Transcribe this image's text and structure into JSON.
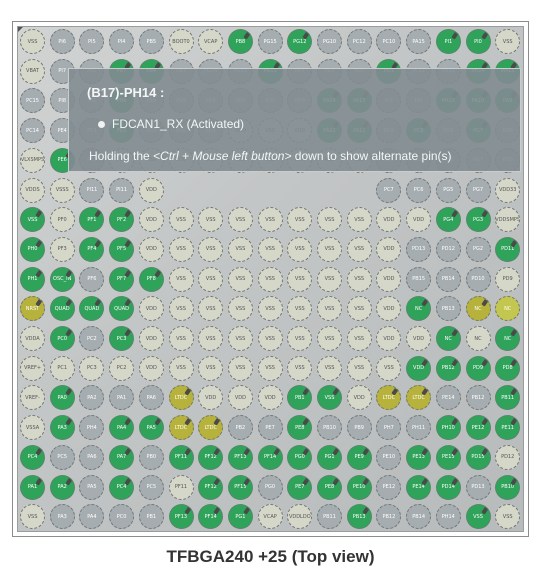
{
  "package": {
    "caption": "TFBGA240 +25 (Top view)",
    "grid_rows": 17,
    "grid_cols": 17,
    "colors": {
      "power_ground": "#d5d7c9",
      "io_unused": "#a6adb1",
      "active": "#2fa35a",
      "reserved": "#b6b23c",
      "nc": "#c3c64f",
      "body": "#c3c6c6"
    }
  },
  "tooltip": {
    "title": "(B17)-PH14 :",
    "signal": "FDCAN1_RX (Activated)",
    "hint_pre": "Holding the ",
    "hint_italic": "<Ctrl + Mouse left button>",
    "hint_post": " down to show alternate pin(s)"
  },
  "balls": [
    [
      "VSS:g",
      "PI6:i",
      "PI5:i",
      "PI4:i",
      "PB5:i",
      "BOOT0:g",
      "VCAP:g",
      "PB8:a",
      "PG15:i",
      "PG12:a",
      "PG10:i",
      "PC12:i",
      "PC10:i",
      "PA15:i",
      "PI1:a",
      "PI0:a",
      "VSS:g"
    ],
    [
      "VBAT:g",
      "PI7:i",
      "PE1:i",
      "PB7:a",
      "PB4:a",
      "PB3:i",
      "PG14:i",
      "PG13:i",
      "PG11:a",
      "PD7:i",
      "PD5:i",
      "PD3:i",
      "PD1:a",
      "PC11:i",
      "PH15:i",
      "PH14:a",
      "PH13:a"
    ],
    [
      "PC15:i",
      "PI8:i",
      "PE0:i",
      "PB6:a",
      "PB9:i",
      "PG9:i",
      "PD6:i",
      "PD4:i",
      "PD2:i",
      "PD0:i",
      "PA14:a",
      "PA13:a",
      "PI3:i",
      "PI2:i",
      "PH12:a",
      "PA10:a",
      "PA9:a"
    ],
    [
      "PC14:i",
      "PE4:i",
      "PE3:i",
      "PE2:a",
      "PG9:i",
      "PD6:i",
      "PD4:i",
      "VDD:g",
      "VSS:g",
      "VDD:g",
      "PA12:a",
      "PA11:a",
      "PC9:i",
      "PC8:a",
      "PG8:i",
      "PG7:a",
      "PG6:i"
    ],
    [
      "VLXSMPS:g",
      "PE6:a",
      "PE5:i",
      "VDD:g",
      "VSS:g",
      "VDD:g",
      "VSS:g",
      "VDD:g",
      "VSS:g",
      "VDD:g",
      "VSS:g",
      "VDD:g",
      "PC9:i",
      "PC8:i",
      "PG8:i",
      "PG7:i",
      "PG6:i"
    ],
    [
      "VDDS:g",
      "VSSS:g",
      "PI11:i",
      "PI11:i",
      "VDD:g",
      "",
      "",
      "",
      "",
      "",
      "",
      "",
      "PC7:i",
      "PC6:i",
      "PG5:i",
      "PG7:i",
      "VDD33:g"
    ],
    [
      "VSS:a",
      "PF0:g",
      "PF1:a",
      "PF2:a",
      "VDD:g",
      "VSS:g",
      "VSS:g",
      "VSS:g",
      "VSS:g",
      "VSS:g",
      "VSS:g",
      "VSS:g",
      "VDD:g",
      "VDD:g",
      "PG4:a",
      "PG3:a",
      "VDDSMPS:g"
    ],
    [
      "PH0:a",
      "PF3:g",
      "PF4:a",
      "PF5:a",
      "VDD:g",
      "VSS:g",
      "VSS:g",
      "VSS:g",
      "VSS:g",
      "VSS:g",
      "VSS:g",
      "VSS:g",
      "VDD:g",
      "PD13:i",
      "PD12:i",
      "PG2:i",
      "PD11:a"
    ],
    [
      "PH1:a",
      "OSC_IN:a",
      "PF6:i",
      "PF7:a",
      "PF8:a",
      "VSS:g",
      "VSS:g",
      "VSS:g",
      "VSS:g",
      "VSS:g",
      "VSS:g",
      "VSS:g",
      "VDD:g",
      "PB15:i",
      "PB14:i",
      "PD10:i",
      "PD9:g"
    ],
    [
      "NRST:r",
      "QUAD:a",
      "QUAD:a",
      "QUAD:a",
      "VDD:g",
      "VSS:g",
      "VSS:g",
      "VSS:g",
      "VSS:g",
      "VSS:g",
      "VSS:g",
      "VSS:g",
      "VDD:g",
      "NC:a",
      "PB13:i",
      "NC:r",
      "NC:n"
    ],
    [
      "VDDA:g",
      "PC0:a",
      "PC2:i",
      "PC3:a",
      "VDD:g",
      "VSS:g",
      "VSS:g",
      "VSS:g",
      "VSS:g",
      "VSS:g",
      "VSS:g",
      "VSS:g",
      "VDD:g",
      "VDD:g",
      "NC:a",
      "NC:g",
      "NC:a"
    ],
    [
      "VREF+:g",
      "PC1:g",
      "PC3:g",
      "PC2:g",
      "VDD:g",
      "VSS:g",
      "VSS:g",
      "VSS:g",
      "VSS:g",
      "VSS:g",
      "VSS:g",
      "VSS:g",
      "VSS:g",
      "VDD:a",
      "PB12:a",
      "PD9:a",
      "PD8:a"
    ],
    [
      "VREF-:g",
      "PA0:a",
      "PA2:i",
      "PA1:i",
      "PA6:i",
      "LTDC:r",
      "VDD:g",
      "VDD:g",
      "VDD:g",
      "PB1:a",
      "VSS:a",
      "VDD:g",
      "LTDC:r",
      "LTDC:r",
      "PE14:i",
      "PB12:i",
      "PB11:a"
    ],
    [
      "VSSA:g",
      "PA3:a",
      "PH4:i",
      "PA4:a",
      "PA5:a",
      "LTDC:r",
      "LTDC:r",
      "PB2:i",
      "PE7:i",
      "PE8:a",
      "PB10:i",
      "PB9:i",
      "PH7:i",
      "PH11:i",
      "PH10:a",
      "PE12:a",
      "PE11:a"
    ],
    [
      "PC4:a",
      "PC5:i",
      "PA6:i",
      "PA7:a",
      "PB0:i",
      "PF11:a",
      "PF12:a",
      "PF13:a",
      "PF14:a",
      "PG0:a",
      "PG1:a",
      "PE9:a",
      "PE10:i",
      "PE13:a",
      "PE15:a",
      "PD15:a",
      "PD12:g"
    ],
    [
      "PA1:a",
      "PA2:a",
      "PA5:i",
      "PC4:a",
      "PC5:i",
      "PF11:g",
      "PF12:a",
      "PF15:a",
      "PG0:i",
      "PE7:a",
      "PE8:a",
      "PE10:a",
      "PE12:i",
      "PE14:a",
      "PD14:a",
      "PD13:i",
      "PB10:a"
    ],
    [
      "VSS:g",
      "PA3:i",
      "PA4:i",
      "PC0:i",
      "PB1:i",
      "PF13:a",
      "PF14:a",
      "PG1:a",
      "VCAP:g",
      "VDDLDO:g",
      "PB11:i",
      "PB13:a",
      "PB12:i",
      "PB14:i",
      "PH14:i",
      "VSS:a",
      "VSS:g"
    ]
  ]
}
